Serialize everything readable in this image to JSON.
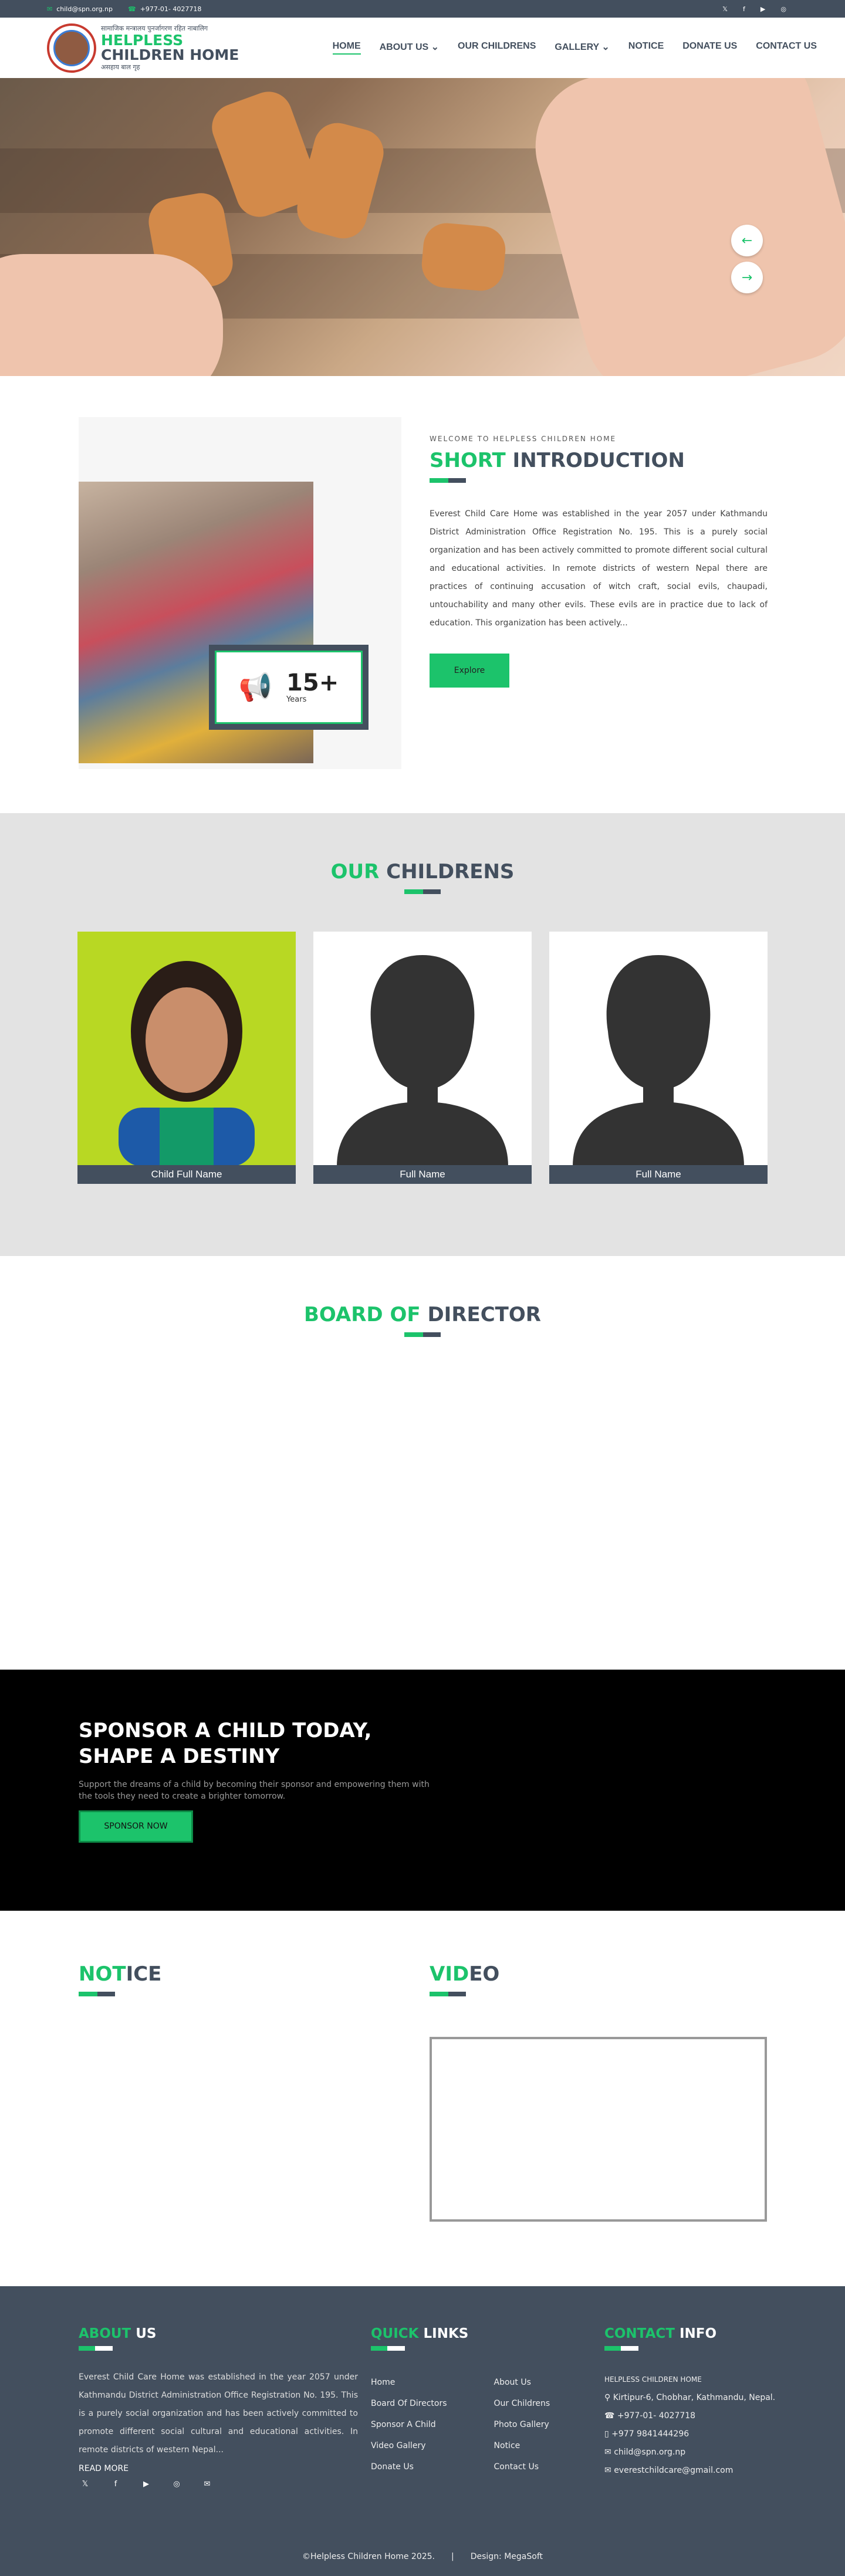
{
  "topbar": {
    "email": "child@spn.org.np",
    "phone": "+977-01- 4027718",
    "social": [
      "twitter-icon",
      "facebook-icon",
      "youtube-icon",
      "instagram-icon"
    ]
  },
  "logo": {
    "devanagari": "सामाजिक मन्त्रालय  पुनर्जागरण  रहित  नाबालिग",
    "line1": "HELPLESS",
    "line2": "CHILDREN HOME",
    "devanagari2": "असहाय बाल गृह"
  },
  "nav": {
    "items": [
      "HOME",
      "ABOUT US",
      "OUR CHILDRENS",
      "GALLERY",
      "NOTICE",
      "DONATE US",
      "CONTACT US"
    ]
  },
  "hero": {
    "prev": "←",
    "next": "→"
  },
  "intro": {
    "eyebrow": "WELCOME TO HELPLESS CHILDREN HOME",
    "title_green": "SHORT",
    "title_dark": " INTRODUCTION",
    "text": "Everest Child Care Home was established in the year 2057 under Kathmandu District Administration Office Registration No. 195. This is a purely social organization and has been actively committed to promote different social cultural and educational activities. In remote districts of western Nepal there are practices of continuing accusation of witch craft, social evils, chaupadi, untouchability and many other evils. These evils are in practice due to lack of education. This organization has been actively...",
    "years_num": "15+",
    "years_label": "Years",
    "button": "Explore"
  },
  "children": {
    "title_green": "OUR",
    "title_dark": " CHILDRENS",
    "cards": [
      "Child Full Name",
      "Full Name",
      "Full Name"
    ]
  },
  "board": {
    "title_green": "BOARD OF",
    "title_dark": " DIRECTOR"
  },
  "sponsor": {
    "title": "SPONSOR A CHILD TODAY,\nSHAPE A DESTINY",
    "text": "Support the dreams of a child by becoming their sponsor and empowering them with the tools they need to create a brighter tomorrow.",
    "button": "SPONSOR NOW"
  },
  "notice": {
    "title_green": "NOT",
    "title_dark": "ICE"
  },
  "video": {
    "title_green": "VID",
    "title_dark": "EO"
  },
  "footer": {
    "about": {
      "title_green": "ABOUT",
      "title_white": " US",
      "text": "Everest Child Care Home was established in the year 2057 under Kathmandu District Administration Office Registration No. 195. This is a purely social organization and has been actively committed to promote different social cultural and educational activities. In remote districts of western Nepal...",
      "read_more": "READ MORE"
    },
    "links": {
      "title_green": "QUICK",
      "title_white": " LINKS",
      "col1": [
        "Home",
        "Board Of Directors",
        "Sponsor A Child",
        "Video Gallery",
        "Donate Us"
      ],
      "col2": [
        "About Us",
        "Our Childrens",
        "Photo Gallery",
        "Notice",
        "Contact Us"
      ]
    },
    "contact": {
      "title_green": "CONTACT",
      "title_white": " INFO",
      "name": "HELPLESS CHILDREN HOME",
      "address": "Kirtipur-6, Chobhar, Kathmandu, Nepal.",
      "phone": "+977-01- 4027718",
      "mobile": "+977 9841444296",
      "email1": "child@spn.org.np",
      "email2": "everestchildcare@gmail.com"
    },
    "social": [
      "twitter-icon",
      "facebook-icon",
      "youtube-icon",
      "instagram-icon",
      "email-icon"
    ],
    "copyright": "©Helpless Children Home 2025.",
    "separator": "|",
    "design": "Design: MegaSoft"
  },
  "colors": {
    "green": "#1cc36b",
    "dark": "#434f5e"
  }
}
